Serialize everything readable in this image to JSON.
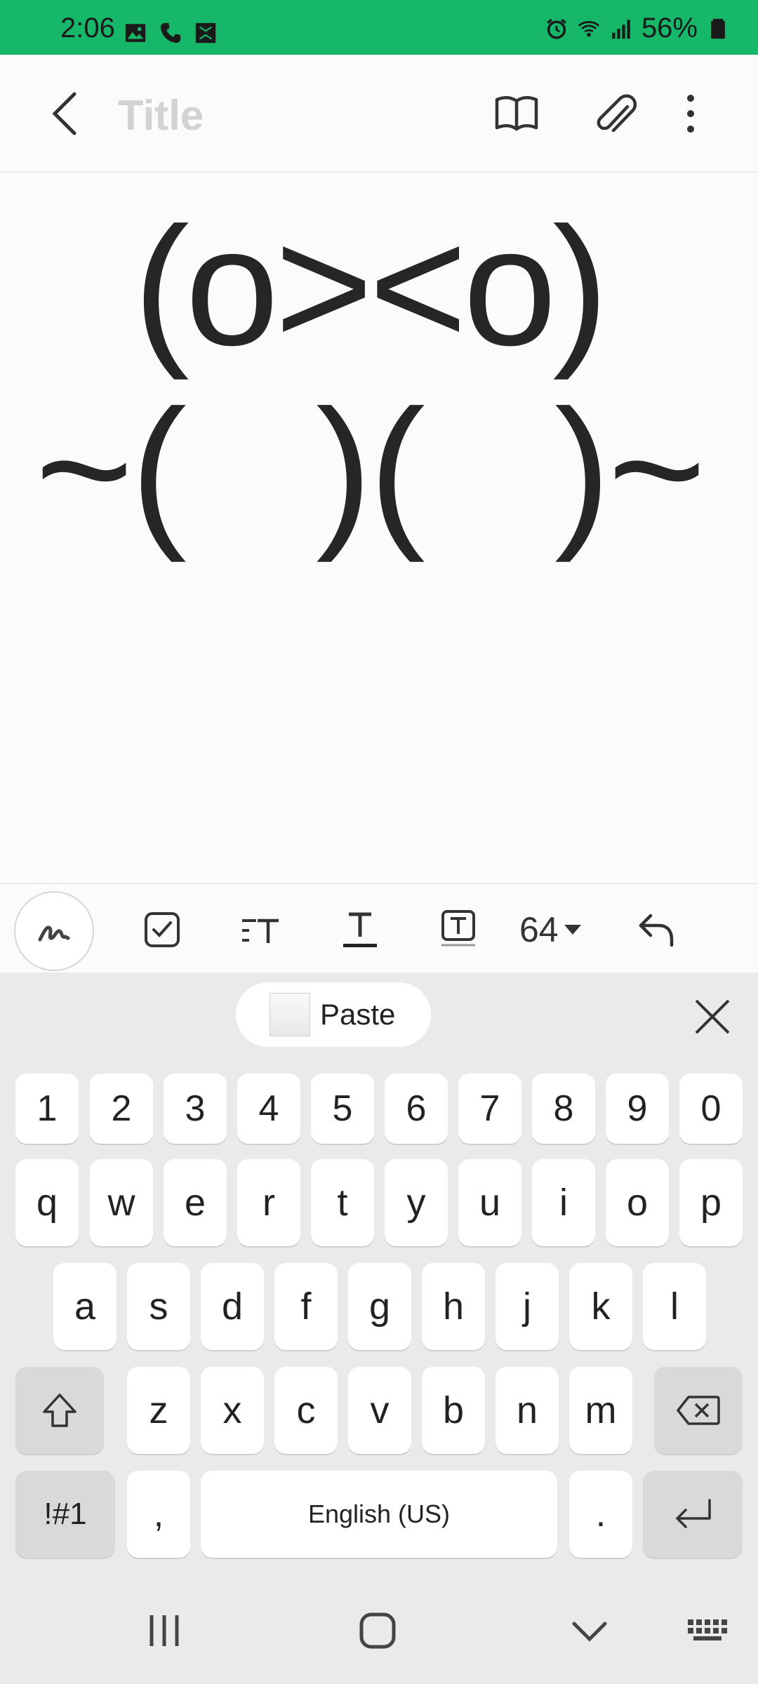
{
  "status_bar": {
    "time": "2:06",
    "battery": "56%",
    "background": "#17b76a",
    "left_icons": [
      "gallery-icon",
      "phone-icon",
      "app-icon"
    ],
    "right_icons": [
      "alarm-icon",
      "wifi-icon",
      "signal-icon",
      "battery-icon"
    ]
  },
  "app_bar": {
    "title_placeholder": "Title",
    "title_value": "",
    "buttons": [
      "back-icon",
      "reading-mode-icon",
      "attach-icon",
      "more-icon"
    ]
  },
  "note": {
    "lines": [
      "(o><o)",
      "~(   )(   )~"
    ]
  },
  "toolbar": {
    "font_size": "64",
    "tools": [
      "pen-icon",
      "checkbox-icon",
      "paragraph-style-icon",
      "text-style-icon",
      "text-box-icon",
      "undo-icon"
    ]
  },
  "clipboard": {
    "paste_label": "Paste"
  },
  "keyboard": {
    "numbers": [
      "1",
      "2",
      "3",
      "4",
      "5",
      "6",
      "7",
      "8",
      "9",
      "0"
    ],
    "row_q": [
      "q",
      "w",
      "e",
      "r",
      "t",
      "y",
      "u",
      "i",
      "o",
      "p"
    ],
    "row_a": [
      "a",
      "s",
      "d",
      "f",
      "g",
      "h",
      "j",
      "k",
      "l"
    ],
    "row_z": [
      "z",
      "x",
      "c",
      "v",
      "b",
      "n",
      "m"
    ],
    "symbols_label": "!#1",
    "comma": ",",
    "space_label": "English (US)",
    "period": "."
  },
  "nav_bar": {
    "buttons": [
      "recents-icon",
      "home-icon",
      "hide-keyboard-icon",
      "keyboard-switch-icon"
    ]
  }
}
